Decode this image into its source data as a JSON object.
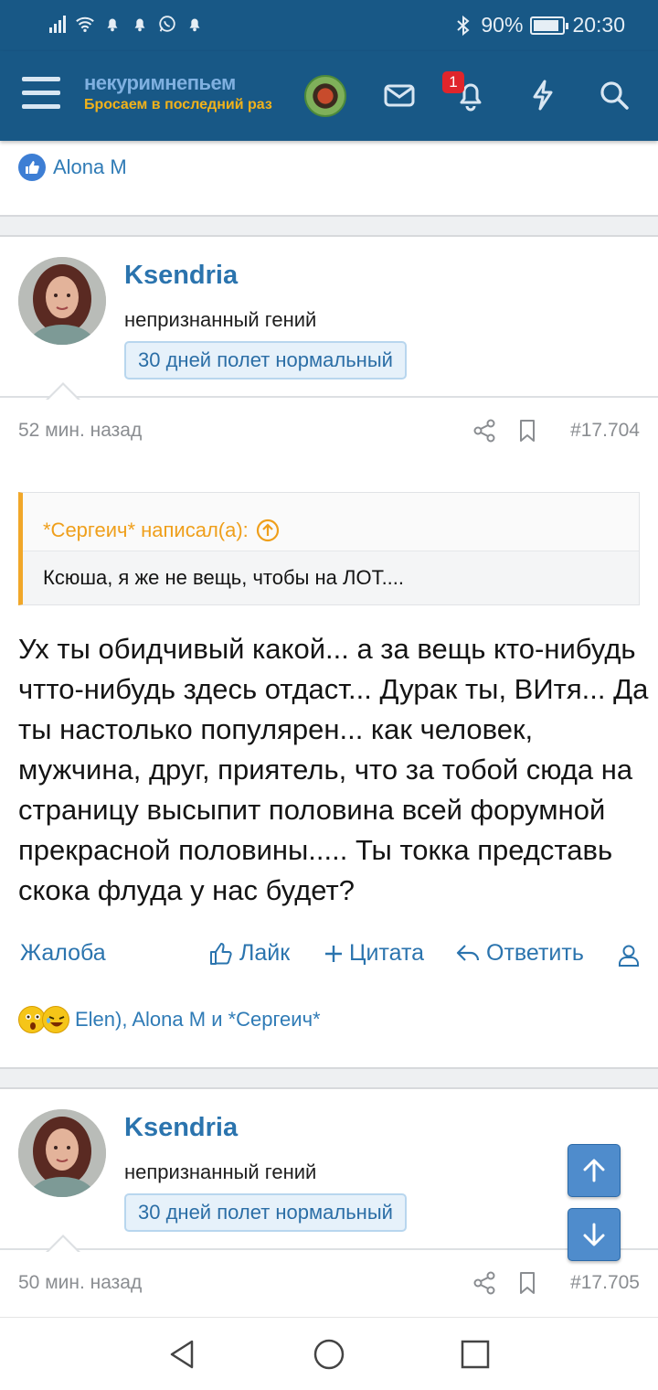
{
  "status_bar": {
    "battery_text": "90%",
    "battery_level": 0.9,
    "time": "20:30"
  },
  "header": {
    "logo_top": "некуримнепьем",
    "logo_bottom": "Бросаем в последний раз",
    "notification_count": "1"
  },
  "prev_post": {
    "reactions_text": "Alona M"
  },
  "posts": [
    {
      "author": "Ksendria",
      "user_title": "непризнанный гений",
      "banner": "30 дней полет нормальный",
      "time": "52 мин. назад",
      "number": "#17.704",
      "quote_author": "*Сергеич* написал(а):",
      "quote_text": "Ксюша, я же не вещь, чтобы на ЛОТ....",
      "text": "Ух ты обидчивый какой... а за вещь кто-нибудь чтто-нибудь здесь отдаст... Дурак ты, ВИтя... Да ты настолько популярен... как человек, мужчина, друг, приятель, что за тобой сюда на страницу высыпит половина всей форумной прекрасной половины..... Ты токка представь скока флуда у нас будет?",
      "actions": {
        "report": "Жалоба",
        "like": "Лайк",
        "quote": "Цитата",
        "reply": "Ответить"
      },
      "reactions_text": "Elen), Alona M и *Сергеич*"
    },
    {
      "author": "Ksendria",
      "user_title": "непризнанный гений",
      "banner": "30 дней полет нормальный",
      "time": "50 мин. назад",
      "number": "#17.705"
    }
  ],
  "icons": {
    "header": [
      "menu-icon",
      "envelope-icon",
      "bell-icon",
      "bolt-icon",
      "search-icon"
    ],
    "nav": [
      "back-icon",
      "home-icon",
      "recents-icon"
    ]
  },
  "colors": {
    "header_bg": "#185886",
    "link": "#2b74ae",
    "quote_accent": "#f1a729",
    "badge": "#e0252b"
  }
}
